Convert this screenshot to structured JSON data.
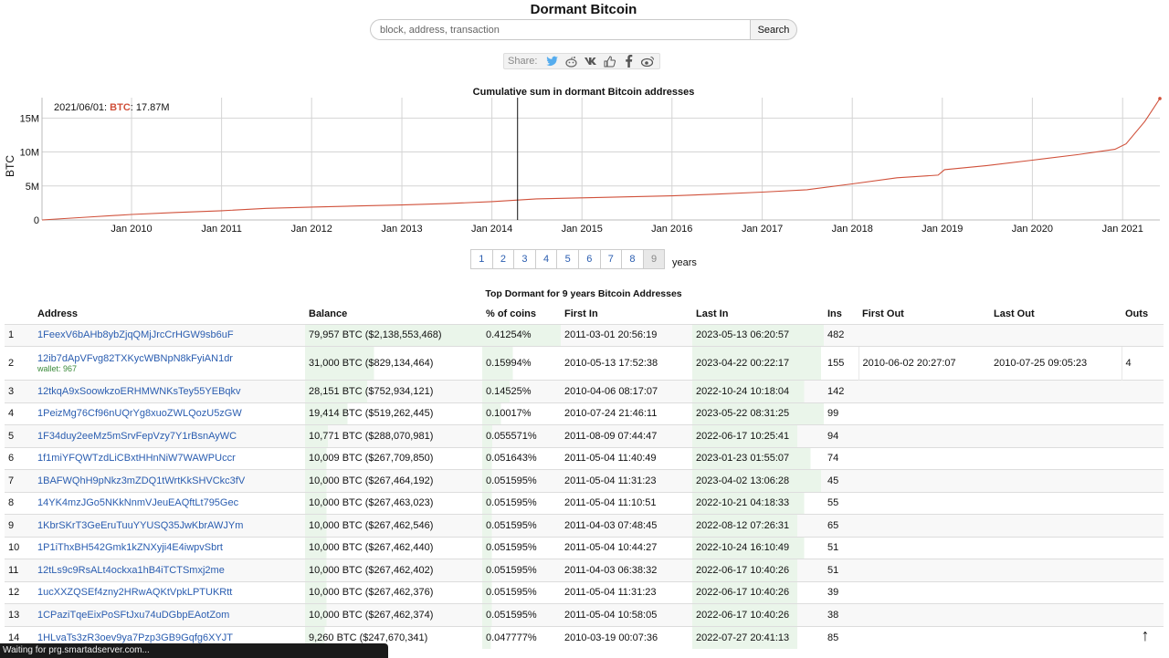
{
  "header": {
    "title": "Dormant Bitcoin",
    "search_placeholder": "block, address, transaction",
    "search_button": "Search",
    "share_label": "Share:"
  },
  "share_icons": [
    "twitter-icon",
    "reddit-icon",
    "vk-icon",
    "like-icon",
    "facebook-icon",
    "weibo-icon"
  ],
  "chart_data": {
    "type": "line",
    "title": "Cumulative sum in dormant Bitcoin addresses",
    "ylabel": "BTC",
    "y_ticks": [
      "0",
      "5M",
      "10M",
      "15M"
    ],
    "x_ticks": [
      "Jan 2010",
      "Jan 2011",
      "Jan 2012",
      "Jan 2013",
      "Jan 2014",
      "Jan 2015",
      "Jan 2016",
      "Jan 2017",
      "Jan 2018",
      "Jan 2019",
      "Jan 2020",
      "Jan 2021"
    ],
    "ylim": [
      0,
      18000000
    ],
    "xlim": [
      "2009-01-03",
      "2021-06-01"
    ],
    "tooltip": {
      "date": "2021/06/01",
      "series": "BTC",
      "value": "17.87M"
    },
    "crosshair_date": "2014-04-15",
    "grid": true,
    "series": [
      {
        "color": "#d0503a",
        "points": [
          [
            "2009-01-03",
            0
          ],
          [
            "2009-07-01",
            400000
          ],
          [
            "2010-01-01",
            800000
          ],
          [
            "2010-07-01",
            1100000
          ],
          [
            "2011-01-01",
            1350000
          ],
          [
            "2011-07-01",
            1700000
          ],
          [
            "2012-01-01",
            1900000
          ],
          [
            "2012-07-01",
            2050000
          ],
          [
            "2013-01-01",
            2200000
          ],
          [
            "2013-07-01",
            2400000
          ],
          [
            "2014-01-01",
            2700000
          ],
          [
            "2014-07-01",
            3100000
          ],
          [
            "2015-01-01",
            3250000
          ],
          [
            "2015-07-01",
            3400000
          ],
          [
            "2016-01-01",
            3550000
          ],
          [
            "2016-07-01",
            3800000
          ],
          [
            "2017-01-01",
            4100000
          ],
          [
            "2017-07-01",
            4450000
          ],
          [
            "2018-01-01",
            5300000
          ],
          [
            "2018-07-01",
            6200000
          ],
          [
            "2018-12-15",
            6600000
          ],
          [
            "2019-01-10",
            7400000
          ],
          [
            "2019-07-01",
            8000000
          ],
          [
            "2020-01-01",
            8800000
          ],
          [
            "2020-07-01",
            9600000
          ],
          [
            "2020-12-01",
            10400000
          ],
          [
            "2021-01-15",
            11200000
          ],
          [
            "2021-04-01",
            14500000
          ],
          [
            "2021-06-01",
            17870000
          ]
        ]
      }
    ]
  },
  "pager": {
    "pages": [
      "1",
      "2",
      "3",
      "4",
      "5",
      "6",
      "7",
      "8",
      "9"
    ],
    "active": "9",
    "suffix": "years"
  },
  "table": {
    "title": "Top Dormant for 9 years Bitcoin Addresses",
    "columns": [
      "",
      "Address",
      "Balance",
      "% of coins",
      "First In",
      "Last In",
      "Ins",
      "First Out",
      "Last Out",
      "Outs"
    ],
    "rows": [
      {
        "n": "1",
        "address": "1FeexV6bAHb8ybZjqQMjJrcCrHGW9sb6uF",
        "wallet": "",
        "balance": "79,957 BTC ($2,138,553,468)",
        "bal_frac": 1.0,
        "pct": "0.41254%",
        "pct_frac": 1.0,
        "first_in": "2011-03-01 20:56:19",
        "fi_frac": 0.0,
        "last_in": "2023-05-13 06:20:57",
        "li_frac": 1.0,
        "ins": "482",
        "first_out": "",
        "last_out": "",
        "outs": ""
      },
      {
        "n": "2",
        "address": "12ib7dApVFvg82TXKycWBNpN8kFyiAN1dr",
        "wallet": "wallet: 967",
        "balance": "31,000 BTC ($829,134,464)",
        "bal_frac": 0.39,
        "pct": "0.15994%",
        "pct_frac": 0.39,
        "first_in": "2010-05-13 17:52:38",
        "fi_frac": 0.0,
        "last_in": "2023-04-22 00:22:17",
        "li_frac": 0.98,
        "ins": "155",
        "first_out": "2010-06-02 20:27:07",
        "last_out": "2010-07-25 09:05:23",
        "outs": "4"
      },
      {
        "n": "3",
        "address": "12tkqA9xSoowkzoERHMWNKsTey55YEBqkv",
        "wallet": "",
        "balance": "28,151 BTC ($752,934,121)",
        "bal_frac": 0.35,
        "pct": "0.14525%",
        "pct_frac": 0.35,
        "first_in": "2010-04-06 08:17:07",
        "fi_frac": 0.0,
        "last_in": "2022-10-24 10:18:04",
        "li_frac": 0.85,
        "ins": "142",
        "first_out": "",
        "last_out": "",
        "outs": ""
      },
      {
        "n": "4",
        "address": "1PeizMg76Cf96nUQrYg8xuoZWLQozU5zGW",
        "wallet": "",
        "balance": "19,414 BTC ($519,262,445)",
        "bal_frac": 0.24,
        "pct": "0.10017%",
        "pct_frac": 0.24,
        "first_in": "2010-07-24 21:46:11",
        "fi_frac": 0.0,
        "last_in": "2023-05-22 08:31:25",
        "li_frac": 1.0,
        "ins": "99",
        "first_out": "",
        "last_out": "",
        "outs": ""
      },
      {
        "n": "5",
        "address": "1F34duy2eeMz5mSrvFepVzy7Y1rBsnAyWC",
        "wallet": "",
        "balance": "10,771 BTC ($288,070,981)",
        "bal_frac": 0.13,
        "pct": "0.055571%",
        "pct_frac": 0.13,
        "first_in": "2011-08-09 07:44:47",
        "fi_frac": 0.0,
        "last_in": "2022-06-17 10:25:41",
        "li_frac": 0.8,
        "ins": "94",
        "first_out": "",
        "last_out": "",
        "outs": ""
      },
      {
        "n": "6",
        "address": "1f1miYFQWTzdLiCBxtHHnNiW7WAWPUccr",
        "wallet": "",
        "balance": "10,009 BTC ($267,709,850)",
        "bal_frac": 0.12,
        "pct": "0.051643%",
        "pct_frac": 0.12,
        "first_in": "2011-05-04 11:40:49",
        "fi_frac": 0.0,
        "last_in": "2023-01-23 01:55:07",
        "li_frac": 0.9,
        "ins": "74",
        "first_out": "",
        "last_out": "",
        "outs": ""
      },
      {
        "n": "7",
        "address": "1BAFWQhH9pNkz3mZDQ1tWrtKkSHVCkc3fV",
        "wallet": "",
        "balance": "10,000 BTC ($267,464,192)",
        "bal_frac": 0.12,
        "pct": "0.051595%",
        "pct_frac": 0.12,
        "first_in": "2011-05-04 11:31:23",
        "fi_frac": 0.0,
        "last_in": "2023-04-02 13:06:28",
        "li_frac": 0.98,
        "ins": "45",
        "first_out": "",
        "last_out": "",
        "outs": ""
      },
      {
        "n": "8",
        "address": "14YK4mzJGo5NKkNnmVJeuEAQftLt795Gec",
        "wallet": "",
        "balance": "10,000 BTC ($267,463,023)",
        "bal_frac": 0.12,
        "pct": "0.051595%",
        "pct_frac": 0.12,
        "first_in": "2011-05-04 11:10:51",
        "fi_frac": 0.0,
        "last_in": "2022-10-21 04:18:33",
        "li_frac": 0.85,
        "ins": "55",
        "first_out": "",
        "last_out": "",
        "outs": ""
      },
      {
        "n": "9",
        "address": "1KbrSKrT3GeEruTuuYYUSQ35JwKbrAWJYm",
        "wallet": "",
        "balance": "10,000 BTC ($267,462,546)",
        "bal_frac": 0.12,
        "pct": "0.051595%",
        "pct_frac": 0.12,
        "first_in": "2011-04-03 07:48:45",
        "fi_frac": 0.0,
        "last_in": "2022-08-12 07:26:31",
        "li_frac": 0.8,
        "ins": "65",
        "first_out": "",
        "last_out": "",
        "outs": ""
      },
      {
        "n": "10",
        "address": "1P1iThxBH542Gmk1kZNXyji4E4iwpvSbrt",
        "wallet": "",
        "balance": "10,000 BTC ($267,462,440)",
        "bal_frac": 0.12,
        "pct": "0.051595%",
        "pct_frac": 0.12,
        "first_in": "2011-05-04 10:44:27",
        "fi_frac": 0.0,
        "last_in": "2022-10-24 16:10:49",
        "li_frac": 0.85,
        "ins": "51",
        "first_out": "",
        "last_out": "",
        "outs": ""
      },
      {
        "n": "11",
        "address": "12tLs9c9RsALt4ockxa1hB4iTCTSmxj2me",
        "wallet": "",
        "balance": "10,000 BTC ($267,462,402)",
        "bal_frac": 0.12,
        "pct": "0.051595%",
        "pct_frac": 0.12,
        "first_in": "2011-04-03 06:38:32",
        "fi_frac": 0.0,
        "last_in": "2022-06-17 10:40:26",
        "li_frac": 0.8,
        "ins": "51",
        "first_out": "",
        "last_out": "",
        "outs": ""
      },
      {
        "n": "12",
        "address": "1ucXXZQSEf4zny2HRwAQKtVpkLPTUKRtt",
        "wallet": "",
        "balance": "10,000 BTC ($267,462,376)",
        "bal_frac": 0.12,
        "pct": "0.051595%",
        "pct_frac": 0.12,
        "first_in": "2011-05-04 11:31:23",
        "fi_frac": 0.0,
        "last_in": "2022-06-17 10:40:26",
        "li_frac": 0.8,
        "ins": "39",
        "first_out": "",
        "last_out": "",
        "outs": ""
      },
      {
        "n": "13",
        "address": "1CPaziTqeEixPoSFtJxu74uDGbpEAotZom",
        "wallet": "",
        "balance": "10,000 BTC ($267,462,374)",
        "bal_frac": 0.12,
        "pct": "0.051595%",
        "pct_frac": 0.12,
        "first_in": "2011-05-04 10:58:05",
        "fi_frac": 0.0,
        "last_in": "2022-06-17 10:40:26",
        "li_frac": 0.8,
        "ins": "38",
        "first_out": "",
        "last_out": "",
        "outs": ""
      },
      {
        "n": "14",
        "address": "1HLvaTs3zR3oev9ya7Pzp3GB9Gqfg6XYJT",
        "wallet": "",
        "balance": "9,260 BTC ($247,670,341)",
        "bal_frac": 0.11,
        "pct": "0.047777%",
        "pct_frac": 0.11,
        "first_in": "2010-03-19 00:07:36",
        "fi_frac": 0.0,
        "last_in": "2022-07-27 20:41:13",
        "li_frac": 0.8,
        "ins": "85",
        "first_out": "",
        "last_out": "",
        "outs": ""
      }
    ]
  },
  "status_bar": "Waiting for prg.smartadserver.com...",
  "scroll_top_icon": "arrow-up-icon",
  "colors": {
    "link": "#2a5db0",
    "line": "#d0503a",
    "bar": "#eaf5ea",
    "wallet": "#3a8a3a"
  }
}
